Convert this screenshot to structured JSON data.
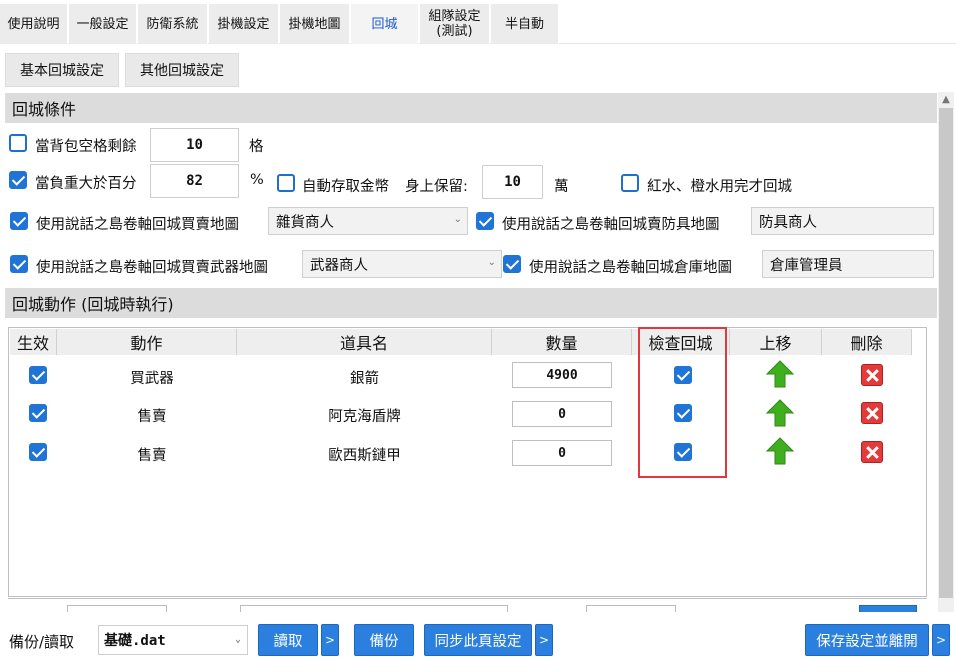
{
  "tabs": [
    {
      "label": "使用說明"
    },
    {
      "label": "一般設定"
    },
    {
      "label": "防衛系統"
    },
    {
      "label": "掛機設定"
    },
    {
      "label": "掛機地圖"
    },
    {
      "label": "回城",
      "active": true
    },
    {
      "label": "組隊設定\n(測試)"
    },
    {
      "label": "半自動"
    }
  ],
  "subtabs": [
    {
      "label": "基本回城設定"
    },
    {
      "label": "其他回城設定"
    }
  ],
  "conditions": {
    "header": "回城條件",
    "bag": {
      "checked": false,
      "label": "當背包空格剩餘",
      "value": "10",
      "unit": "格"
    },
    "weight": {
      "checked": true,
      "label": "當負重大於百分",
      "value": "82",
      "unit": "%"
    },
    "gold": {
      "checked": false,
      "label": "自動存取金幣",
      "keep_label": "身上保留:",
      "value": "10",
      "unit": "萬"
    },
    "potion": {
      "checked": false,
      "label": "紅水、橙水用完才回城"
    },
    "scroll_grocery": {
      "checked": true,
      "label": "使用說話之島卷軸回城買賣地圖",
      "value": "雜貨商人"
    },
    "scroll_armor": {
      "checked": true,
      "label": "使用說話之島卷軸回城賣防具地圖",
      "value": "防具商人"
    },
    "scroll_weapon": {
      "checked": true,
      "label": "使用說話之島卷軸回城買賣武器地圖",
      "value": "武器商人"
    },
    "scroll_warehouse": {
      "checked": true,
      "label": "使用說話之島卷軸回城倉庫地圖",
      "value": "倉庫管理員"
    }
  },
  "actions": {
    "header": "回城動作 (回城時執行)",
    "columns": [
      "生效",
      "動作",
      "道具名",
      "數量",
      "檢查回城",
      "上移",
      "刪除"
    ],
    "rows": [
      {
        "enabled": true,
        "action": "買武器",
        "item": "銀箭",
        "qty": "4900",
        "check": true
      },
      {
        "enabled": true,
        "action": "售賣",
        "item": "阿克海盾牌",
        "qty": "0",
        "check": true
      },
      {
        "enabled": true,
        "action": "售賣",
        "item": "歐西斯鏈甲",
        "qty": "0",
        "check": true
      }
    ]
  },
  "footer": {
    "backup_label": "備份/讀取",
    "file": "基礎.dat",
    "load": "讀取",
    "more": ">",
    "backup": "備份",
    "sync": "同步此頁設定",
    "save": "保存設定並離開"
  },
  "icons": {
    "up": "green-up-arrow-icon",
    "delete": "red-x-icon",
    "dropdown": "chevron-down-icon"
  },
  "colors": {
    "accent": "#2b7fde",
    "active_tab": "#1a56d6",
    "highlight": "#e0383e",
    "delete": "#e33a3a",
    "up": "#3fae1f"
  }
}
